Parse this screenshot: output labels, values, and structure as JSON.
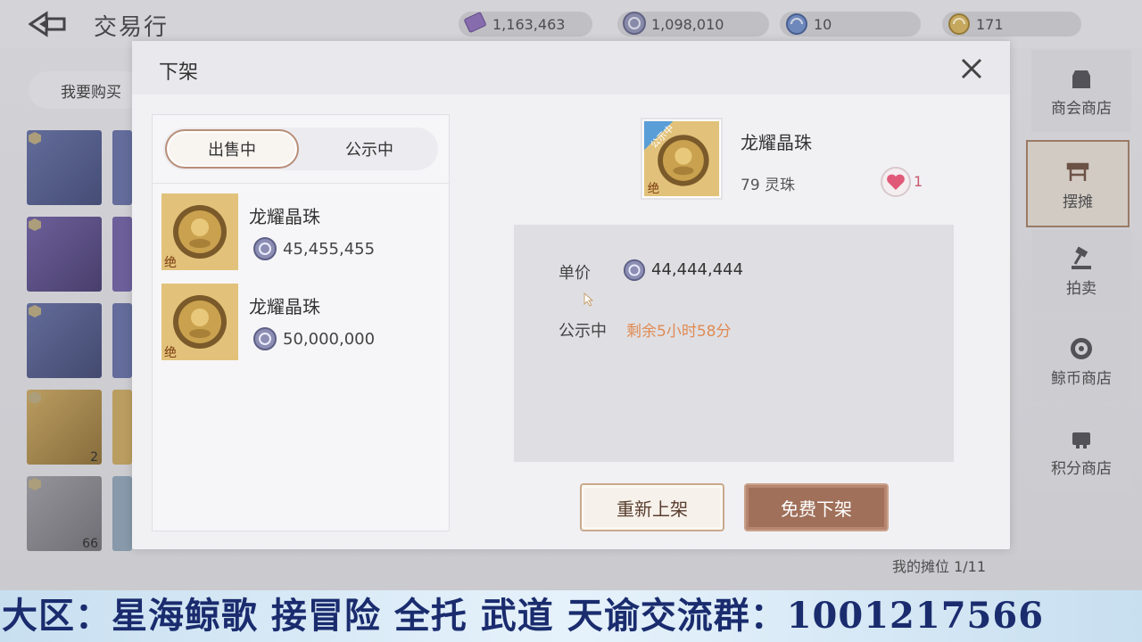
{
  "header": {
    "title": "交易行"
  },
  "currencies": [
    {
      "icon": "purple-ticket-icon",
      "value": "1,163,463"
    },
    {
      "icon": "silver-coin-icon",
      "value": "1,098,010"
    },
    {
      "icon": "blue-shell-icon",
      "value": "10"
    },
    {
      "icon": "gold-shell-icon",
      "value": "171"
    }
  ],
  "background": {
    "want_buy_label": "我要购买",
    "grid_counts": [
      "2",
      "66"
    ],
    "side_tabs": [
      {
        "label": "商会商店",
        "icon": "shop-icon"
      },
      {
        "label": "摆摊",
        "icon": "stall-icon"
      },
      {
        "label": "拍卖",
        "icon": "gavel-icon"
      },
      {
        "label": "鲸币商店",
        "icon": "whale-coin-icon"
      },
      {
        "label": "积分商店",
        "icon": "points-shop-icon"
      }
    ],
    "my_stall": "我的摊位 1/11"
  },
  "modal": {
    "title": "下架",
    "tabs": {
      "selling": "出售中",
      "public": "公示中"
    },
    "items": [
      {
        "name": "龙耀晶珠",
        "price": "45,455,455",
        "tag": "绝"
      },
      {
        "name": "龙耀晶珠",
        "price": "50,000,000",
        "tag": "绝"
      }
    ],
    "detail": {
      "name": "龙耀晶珠",
      "ribbon": "公示中",
      "tag": "绝",
      "quantity": "79 灵珠",
      "favorites": "1",
      "unit_price_label": "单价",
      "unit_price": "44,444,444",
      "status_label": "公示中",
      "status_value": "剩余5小时58分"
    },
    "buttons": {
      "relist": "重新上架",
      "delist": "免费下架"
    }
  },
  "banner": {
    "text": "大区：星海鲸歌 接冒险 全托 武道 天谕交流群：1001217566"
  }
}
